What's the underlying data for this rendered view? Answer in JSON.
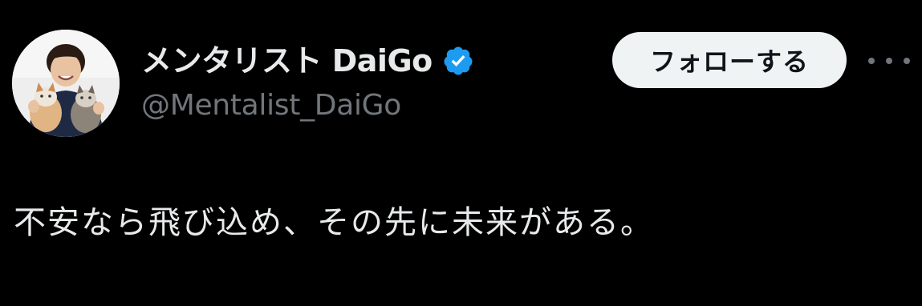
{
  "author": {
    "display_name": "メンタリスト DaiGo",
    "handle": "@Mentalist_DaiGo",
    "verified": true,
    "avatar_icon": "profile-photo-with-cats"
  },
  "actions": {
    "follow_label": "フォローする",
    "more_icon": "ellipsis-icon"
  },
  "tweet": {
    "text": "不安なら飛び込め、その先に未来がある。"
  },
  "colors": {
    "background": "#000000",
    "name_text": "#e7e9ea",
    "handle_text": "#71767b",
    "verified_badge": "#1d9bf0",
    "follow_button_bg": "#eff3f4",
    "follow_button_text": "#0f1419"
  }
}
